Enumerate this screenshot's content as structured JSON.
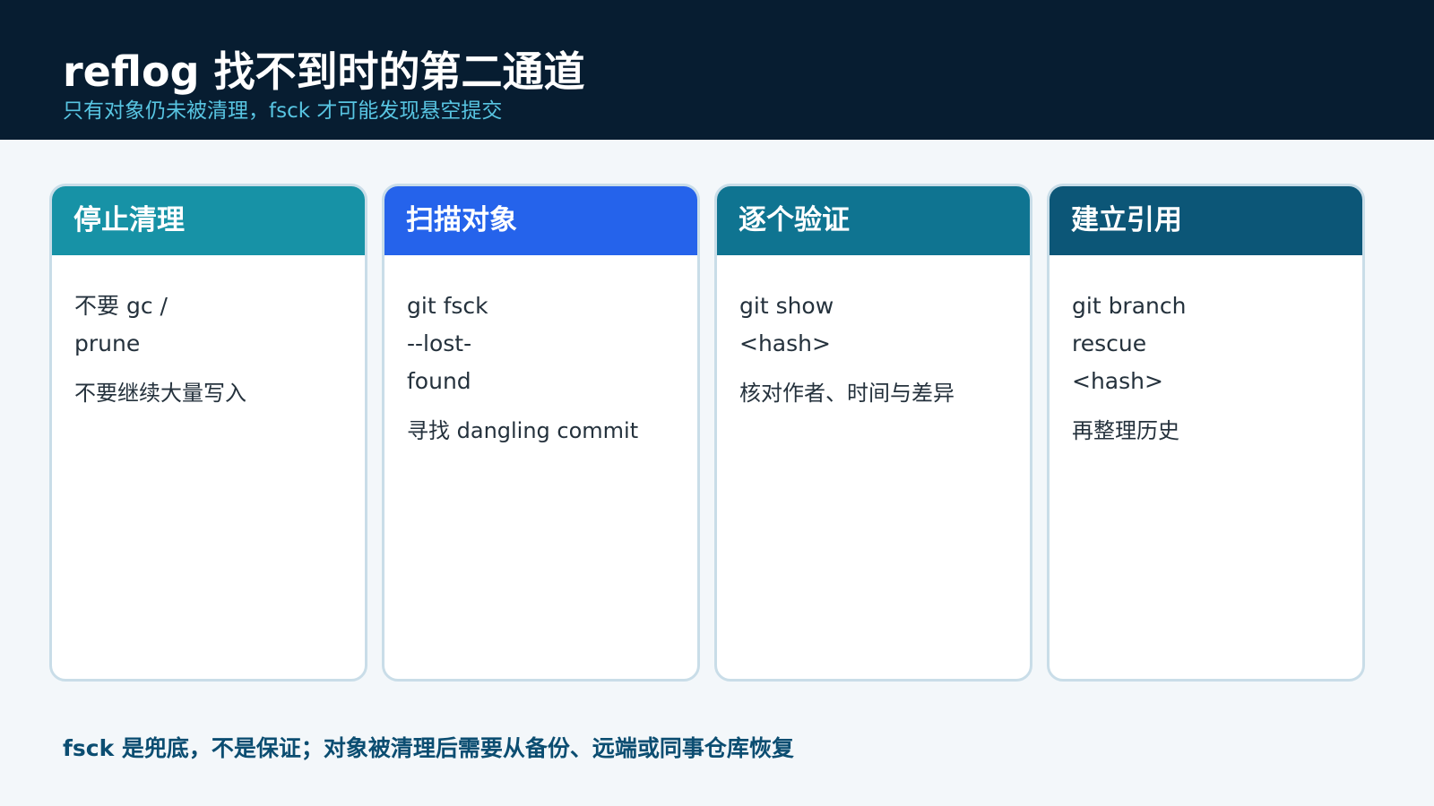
{
  "header": {
    "title": "reflog 找不到时的第二通道",
    "subtitle": "只有对象仍未被清理，fsck 才可能发现悬空提交"
  },
  "cards": [
    {
      "title": "停止清理",
      "lines": [
        "不要 gc /",
        "prune"
      ],
      "note": "不要继续大量写入",
      "color": "#1792a6"
    },
    {
      "title": "扫描对象",
      "lines": [
        "git fsck",
        "--lost-",
        "found"
      ],
      "note": "寻找 dangling commit",
      "color": "#2563eb"
    },
    {
      "title": "逐个验证",
      "lines": [
        "git show",
        "<hash>"
      ],
      "note": "核对作者、时间与差异",
      "color": "#0f7491"
    },
    {
      "title": "建立引用",
      "lines": [
        "git branch",
        "rescue",
        "<hash>"
      ],
      "note": "再整理历史",
      "color": "#0c5677"
    }
  ],
  "footer": {
    "text": "fsck 是兜底，不是保证；对象被清理后需要从备份、远端或同事仓库恢复"
  }
}
